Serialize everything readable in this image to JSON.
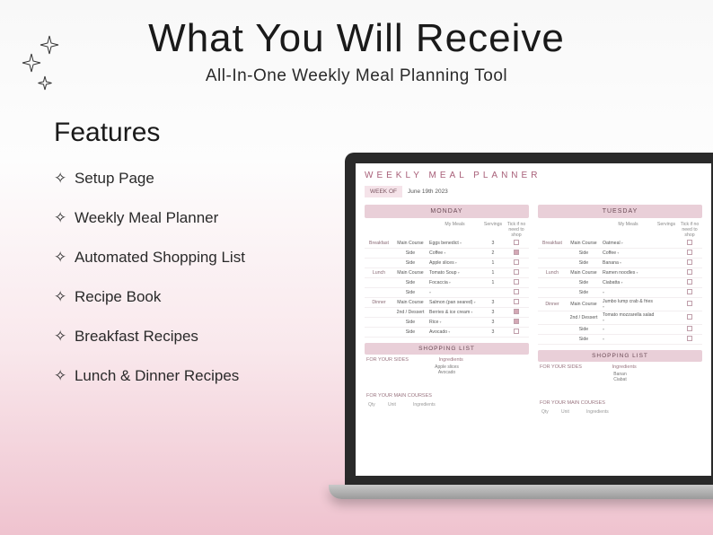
{
  "title": "What You Will Receive",
  "subtitle": "All-In-One Weekly Meal Planning Tool",
  "featuresHeading": "Features",
  "features": [
    "Setup Page",
    "Weekly Meal Planner",
    "Automated Shopping List",
    "Recipe Book",
    "Breakfast Recipes",
    "Lunch & Dinner Recipes"
  ],
  "planner": {
    "title": "WEEKLY MEAL PLANNER",
    "weekOfLabel": "WEEK OF",
    "weekOfValue": "June 19th 2023",
    "mealsHead": "My Meals",
    "servingsHead": "Servings",
    "tickHead": "Tick if no need to shop",
    "shoppingHeader": "SHOPPING LIST",
    "sidesLabel": "FOR YOUR SIDES",
    "mainsLabel": "FOR YOUR MAIN COURSES",
    "ingredientsLabel": "Ingredients",
    "qtyLabel": "Qty",
    "unitLabel": "Unit",
    "days": [
      {
        "name": "MONDAY",
        "meals": [
          {
            "cat": "Breakfast",
            "type": "Main Course",
            "food": "Eggs benedict",
            "srv": "3",
            "chk": false
          },
          {
            "cat": "",
            "type": "Side",
            "food": "Coffee",
            "srv": "2",
            "chk": true
          },
          {
            "cat": "",
            "type": "Side",
            "food": "Apple slices",
            "srv": "1",
            "chk": false
          },
          {
            "cat": "Lunch",
            "type": "Main Course",
            "food": "Tomato Soup",
            "srv": "1",
            "chk": false
          },
          {
            "cat": "",
            "type": "Side",
            "food": "Focaccia",
            "srv": "1",
            "chk": false
          },
          {
            "cat": "",
            "type": "Side",
            "food": "",
            "srv": "",
            "chk": false
          },
          {
            "cat": "Dinner",
            "type": "Main Course",
            "food": "Salmon (pan seared)",
            "srv": "3",
            "chk": false
          },
          {
            "cat": "",
            "type": "2nd / Dessert",
            "food": "Berries & ice cream",
            "srv": "3",
            "chk": true
          },
          {
            "cat": "",
            "type": "Side",
            "food": "Rice",
            "srv": "3",
            "chk": true
          },
          {
            "cat": "",
            "type": "Side",
            "food": "Avocado",
            "srv": "3",
            "chk": false
          }
        ],
        "sideIngredients": [
          "Apple slices",
          "Avocado"
        ]
      },
      {
        "name": "TUESDAY",
        "meals": [
          {
            "cat": "Breakfast",
            "type": "Main Course",
            "food": "Oatmeal",
            "srv": "",
            "chk": false
          },
          {
            "cat": "",
            "type": "Side",
            "food": "Coffee",
            "srv": "",
            "chk": false
          },
          {
            "cat": "",
            "type": "Side",
            "food": "Banana",
            "srv": "",
            "chk": false
          },
          {
            "cat": "Lunch",
            "type": "Main Course",
            "food": "Ramen noodles",
            "srv": "",
            "chk": false
          },
          {
            "cat": "",
            "type": "Side",
            "food": "Ciabatta",
            "srv": "",
            "chk": false
          },
          {
            "cat": "",
            "type": "Side",
            "food": "",
            "srv": "",
            "chk": false
          },
          {
            "cat": "Dinner",
            "type": "Main Course",
            "food": "Jumbo lump crab & fries",
            "srv": "",
            "chk": false
          },
          {
            "cat": "",
            "type": "2nd / Dessert",
            "food": "Tomato mozzarella salad",
            "srv": "",
            "chk": false
          },
          {
            "cat": "",
            "type": "Side",
            "food": "",
            "srv": "",
            "chk": false
          },
          {
            "cat": "",
            "type": "Side",
            "food": "",
            "srv": "",
            "chk": false
          }
        ],
        "sideIngredients": [
          "Banan",
          "Ciabat"
        ]
      }
    ]
  }
}
